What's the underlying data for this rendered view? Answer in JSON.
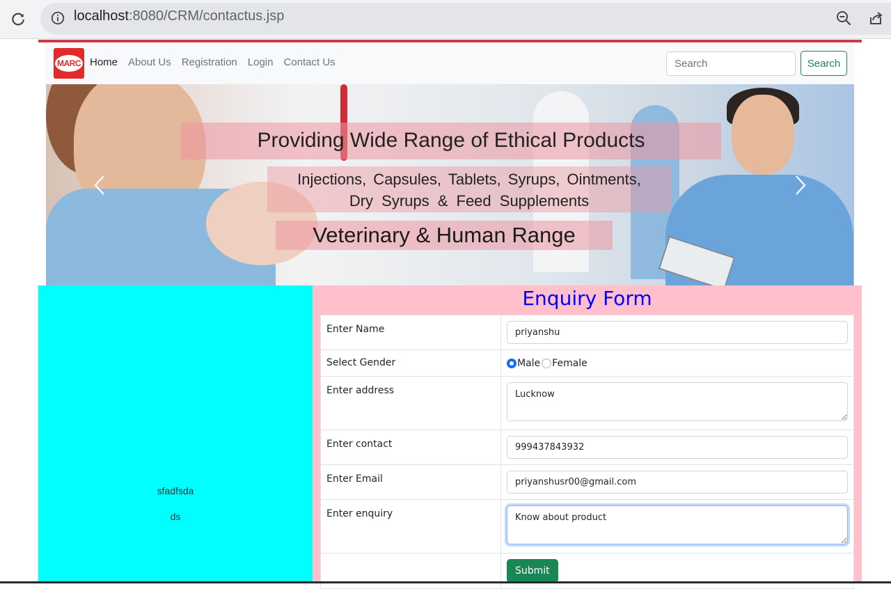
{
  "browser": {
    "url_host": "localhost",
    "url_path": ":8080/CRM/contactus.jsp",
    "icons": [
      "reload-icon",
      "info-icon",
      "zoom-out-icon",
      "share-icon"
    ]
  },
  "navbar": {
    "logo_text": "MARC",
    "links": [
      "Home",
      "About Us",
      "Registration",
      "Login",
      "Contact Us"
    ],
    "active_link": "Home",
    "search_placeholder": "Search",
    "search_button": "Search",
    "colors": {
      "accent": "#198754",
      "stripe": "#cc3b4a"
    }
  },
  "banner": {
    "title": "Providing Wide Range of Ethical Products",
    "line2": "Injections, Capsules, Tablets, Syrups, Ointments,",
    "line3": "Dry Syrups & Feed Supplements",
    "line4": "Veterinary & Human Range"
  },
  "sidebar": {
    "text1": "sfadfsda",
    "text2": "ds",
    "background": "#00ffff"
  },
  "form": {
    "title": "Enquiry Form",
    "background": "#ffc0cb",
    "title_color": "#0000ff",
    "name_label": "Enter Name",
    "name_value": "priyanshu",
    "gender_label": "Select Gender",
    "gender_options": [
      "Male",
      "Female"
    ],
    "gender_selected": "Male",
    "address_label": "Enter address",
    "address_value": "Lucknow",
    "contact_label": "Enter contact",
    "contact_value": "999437843932",
    "email_label": "Enter Email",
    "email_value": "priyanshusr00@gmail.com",
    "enquiry_label": "Enter enquiry",
    "enquiry_value": "Know about product",
    "submit_label": "Submit"
  }
}
